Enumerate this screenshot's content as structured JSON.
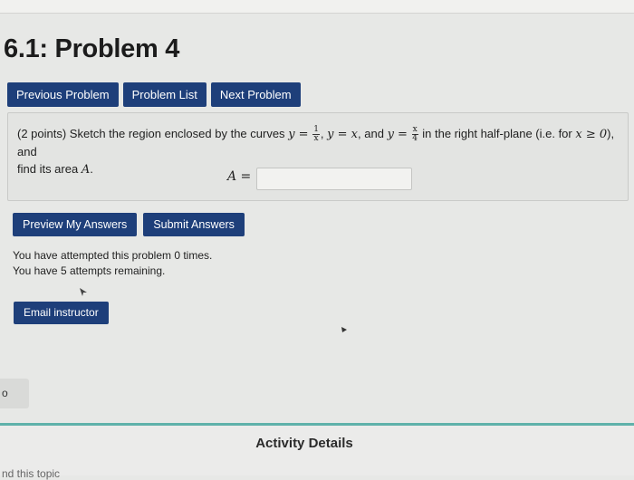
{
  "page": {
    "title": "6.1: Problem 4"
  },
  "nav": {
    "previous": "Previous Problem",
    "list": "Problem List",
    "next": "Next Problem"
  },
  "problem": {
    "points": "(2 points) Sketch the region enclosed by the curves",
    "eq1_lhs": "y =",
    "frac1_num": "1",
    "frac1_den": "x",
    "comma1": ",",
    "eq2": "y = x",
    "and_text": ", and",
    "eq3_lhs": "y =",
    "frac2_num": "x",
    "frac2_den": "4",
    "halfplane": "in the right half-plane (i.e. for",
    "cond": "x ≥ 0",
    "end1": "), and",
    "line2_pre": "find its area",
    "area_var": "A",
    "period": "."
  },
  "answer": {
    "label": "A =",
    "value": ""
  },
  "actions": {
    "preview": "Preview My Answers",
    "submit": "Submit Answers"
  },
  "attempts": {
    "line1": "You have attempted this problem 0 times.",
    "line2": "You have 5 attempts remaining."
  },
  "email": {
    "label": "Email instructor"
  },
  "sidebar": {
    "tab_label": "o"
  },
  "footer": {
    "title": "Activity Details",
    "cutoff_text": "nd this topic"
  },
  "colors": {
    "button_bg": "#1e3f7a",
    "accent_line": "#5fb1aa"
  }
}
